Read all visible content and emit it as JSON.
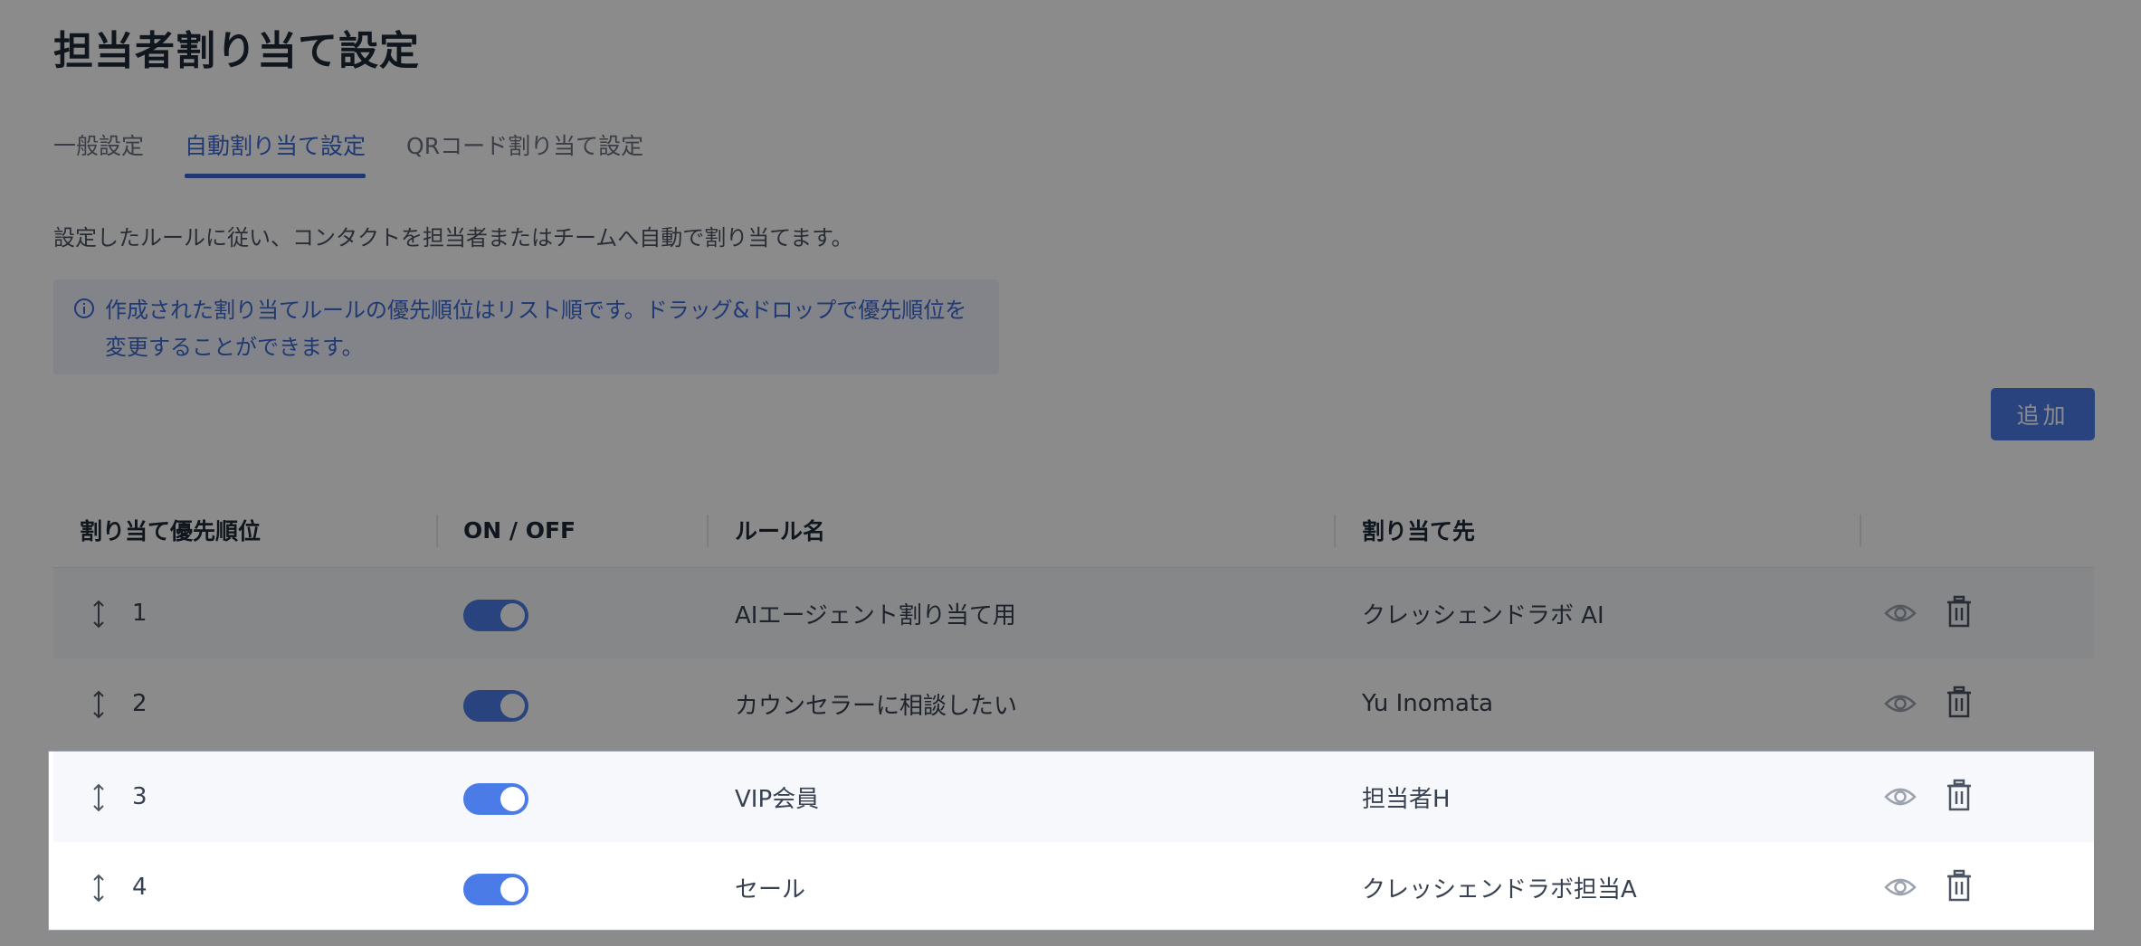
{
  "page": {
    "title": "担当者割り当て設定"
  },
  "tabs": [
    {
      "label": "一般設定",
      "active": false
    },
    {
      "label": "自動割り当て設定",
      "active": true
    },
    {
      "label": "QRコード割り当て設定",
      "active": false
    }
  ],
  "description": "設定したルールに従い、コンタクトを担当者またはチームへ自動で割り当てます。",
  "alert": {
    "icon": "info-icon",
    "text": "作成された割り当てルールの優先順位はリスト順です。ドラッグ&ドロップで優先順位を変更することができます。"
  },
  "add_button": {
    "label": "追加"
  },
  "table": {
    "headers": {
      "priority": "割り当て優先順位",
      "onoff": "ON / OFF",
      "rule_name": "ルール名",
      "assignee": "割り当て先"
    },
    "rows": [
      {
        "priority": "1",
        "on": true,
        "rule_name": "AIエージェント割り当て用",
        "assignee": "クレッシェンドラボ AI"
      },
      {
        "priority": "2",
        "on": true,
        "rule_name": "カウンセラーに相談したい",
        "assignee": "Yu Inomata"
      },
      {
        "priority": "3",
        "on": true,
        "rule_name": "VIP会員",
        "assignee": "担当者H"
      },
      {
        "priority": "4",
        "on": true,
        "rule_name": "セール",
        "assignee": "クレッシェンドラボ担当A"
      }
    ]
  },
  "colors": {
    "accent": "#4a7be6",
    "text": "#374151"
  }
}
